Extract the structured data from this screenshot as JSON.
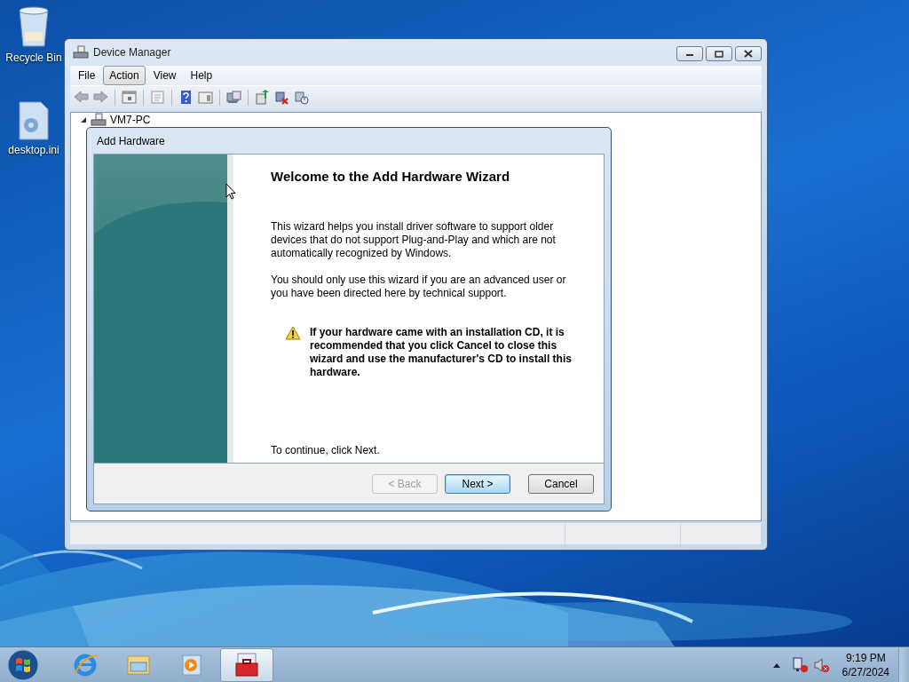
{
  "desktop_icons": [
    {
      "label": "Recycle Bin",
      "kind": "bin"
    },
    {
      "label": "desktop.ini",
      "kind": "file"
    }
  ],
  "device_manager": {
    "title": "Device Manager",
    "menu": [
      {
        "label": "File",
        "selected": false
      },
      {
        "label": "Action",
        "selected": true
      },
      {
        "label": "View",
        "selected": false
      },
      {
        "label": "Help",
        "selected": false
      }
    ],
    "tree": [
      {
        "label": "VM7-PC",
        "expanded": true
      }
    ]
  },
  "wizard": {
    "title": "Add Hardware",
    "heading": "Welcome to the Add Hardware Wizard",
    "paragraphs": [
      "This wizard helps you install driver software to support older devices that do not support Plug-and-Play and which are not automatically recognized by Windows.",
      "You should only use this wizard if you are an advanced user or you have been directed here by technical support."
    ],
    "warning": "If your hardware came with an installation CD, it is recommended that you click Cancel to close this wizard and use the manufacturer's CD to install this hardware.",
    "footer": "To continue, click Next.",
    "buttons": [
      {
        "label": "< Back",
        "disabled": true,
        "default": false
      },
      {
        "label": "Next >",
        "disabled": false,
        "default": true
      },
      {
        "label": "Cancel",
        "disabled": false,
        "default": false
      }
    ]
  },
  "taskbar": {
    "pinned": [
      {
        "kind": "browser",
        "selected": false
      },
      {
        "kind": "folder",
        "selected": false
      },
      {
        "kind": "media",
        "selected": false
      },
      {
        "kind": "toolbox",
        "selected": true
      }
    ],
    "clock": {
      "time": "9:19 PM",
      "date": "6/27/2024"
    }
  }
}
